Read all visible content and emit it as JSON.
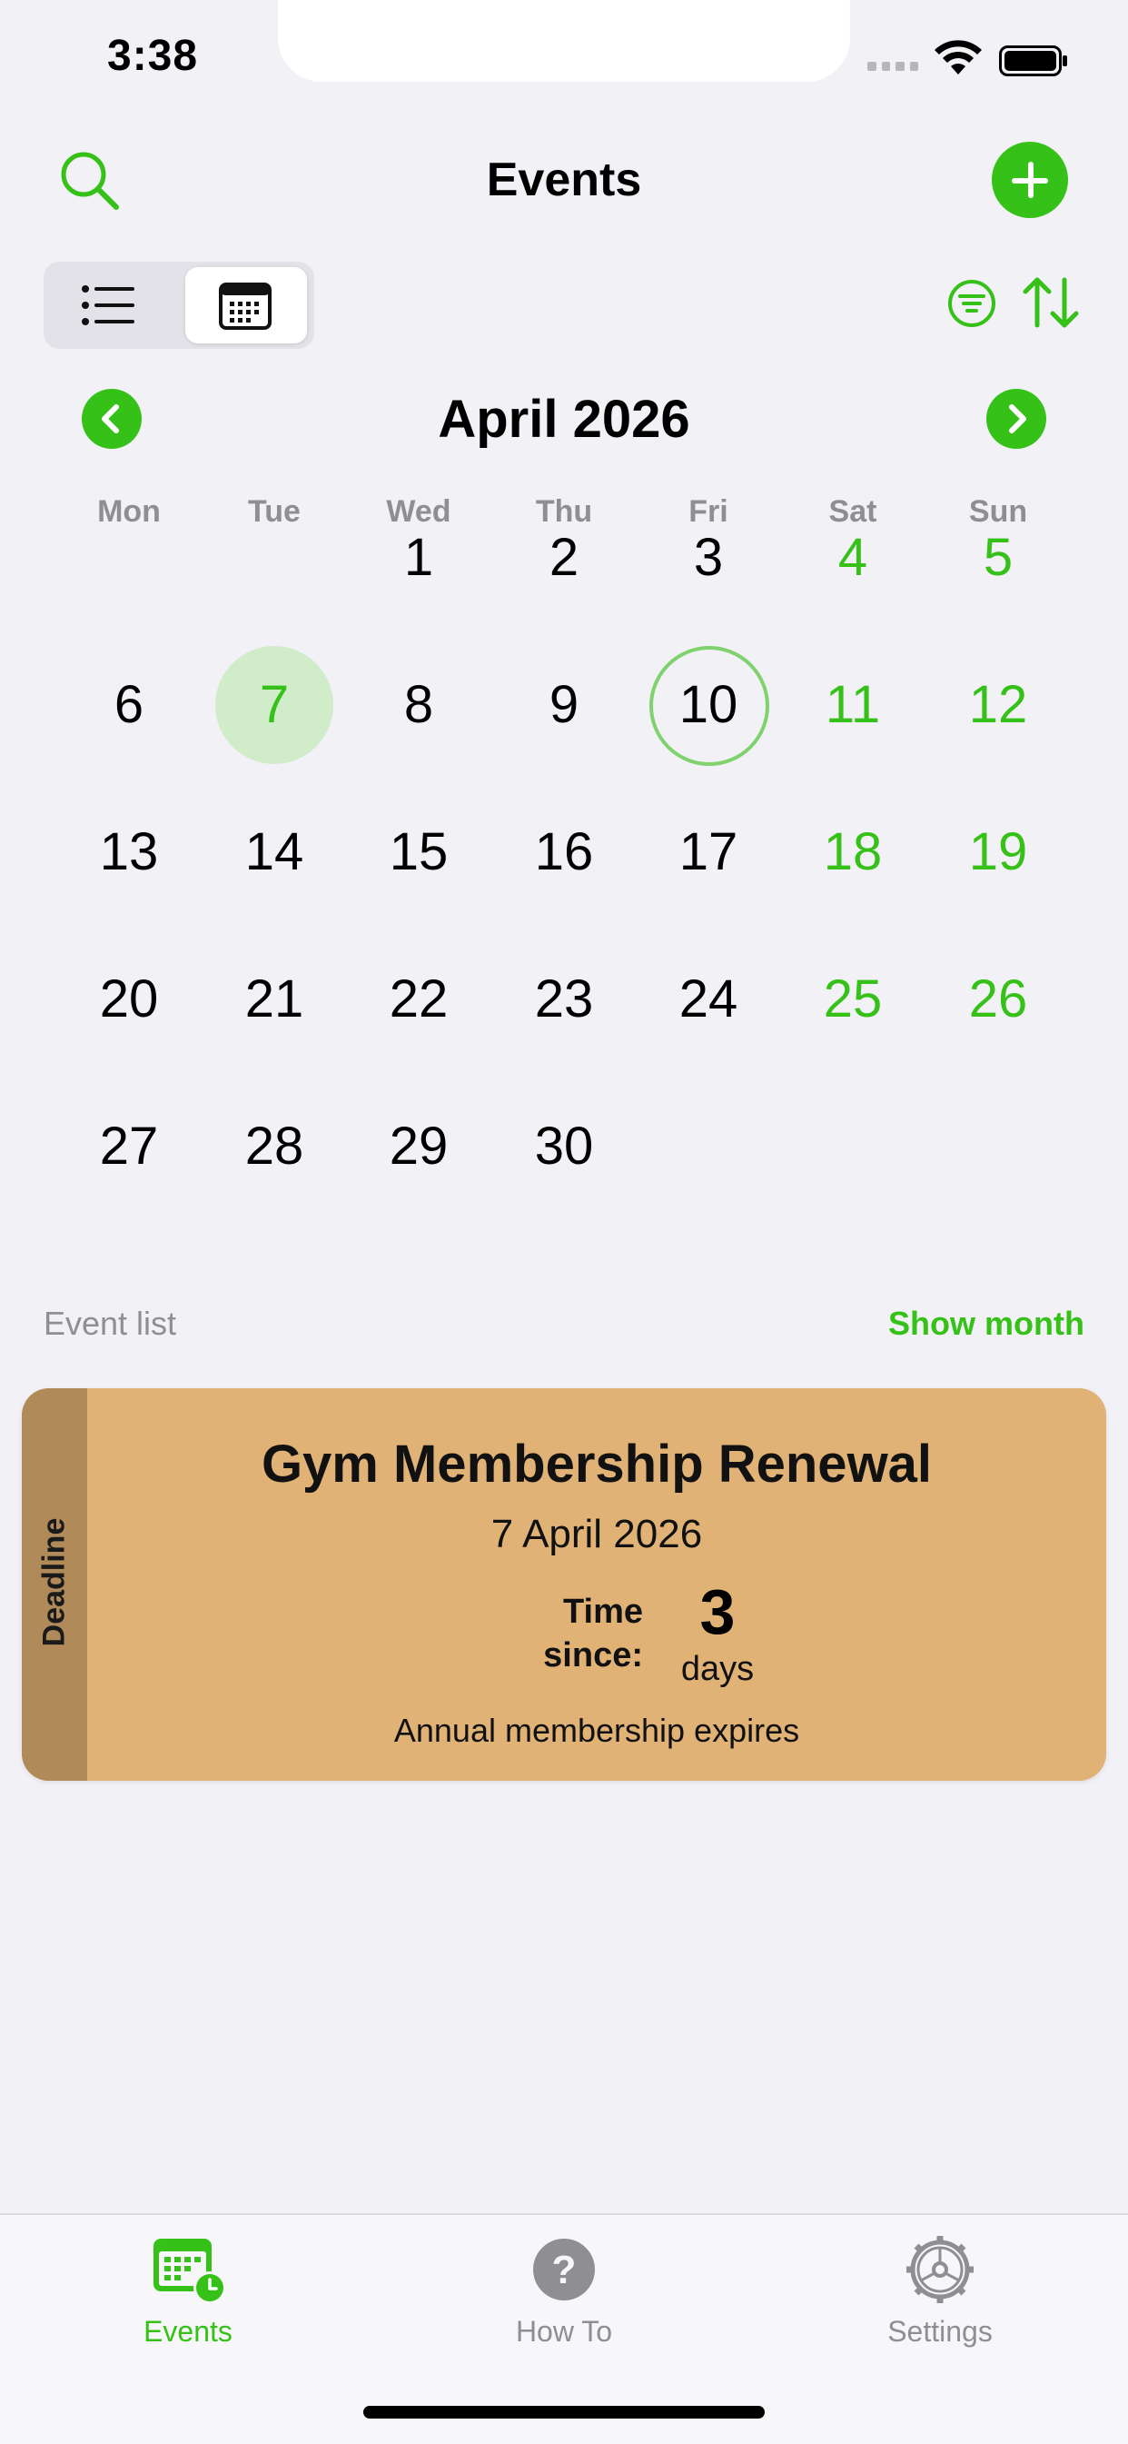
{
  "status_bar": {
    "time": "3:38"
  },
  "header": {
    "title": "Events",
    "search_icon": "search-icon",
    "add_icon": "plus-icon"
  },
  "view_toggle": {
    "options": [
      "list-icon",
      "calendar-icon"
    ],
    "selected": "calendar-icon"
  },
  "toolbar": {
    "filter_icon": "filter-icon",
    "sort_icon": "sort-icon"
  },
  "calendar": {
    "month_title": "April 2026",
    "weekdays": [
      "Mon",
      "Tue",
      "Wed",
      "Thu",
      "Fri",
      "Sat",
      "Sun"
    ],
    "weeks": [
      [
        "",
        "",
        "1",
        "2",
        "3",
        "4",
        "5"
      ],
      [
        "6",
        "7",
        "8",
        "9",
        "10",
        "11",
        "12"
      ],
      [
        "13",
        "14",
        "15",
        "16",
        "17",
        "18",
        "19"
      ],
      [
        "20",
        "21",
        "22",
        "23",
        "24",
        "25",
        "26"
      ],
      [
        "27",
        "28",
        "29",
        "30",
        "",
        "",
        ""
      ]
    ],
    "selected_day": "7",
    "today": "10",
    "accent_color": "#35c118"
  },
  "event_section": {
    "label": "Event list",
    "show_month": "Show month"
  },
  "event_card": {
    "type_label": "Deadline",
    "title": "Gym Membership Renewal",
    "date": "7 April 2026",
    "since_label_1": "Time",
    "since_label_2": "since:",
    "count": "3",
    "unit": "days",
    "note": "Annual membership expires",
    "color": "#e0b276"
  },
  "tabs": [
    {
      "label": "Events",
      "icon": "calendar-clock-icon",
      "active": true
    },
    {
      "label": "How To",
      "icon": "question-icon",
      "active": false
    },
    {
      "label": "Settings",
      "icon": "gear-icon",
      "active": false
    }
  ]
}
